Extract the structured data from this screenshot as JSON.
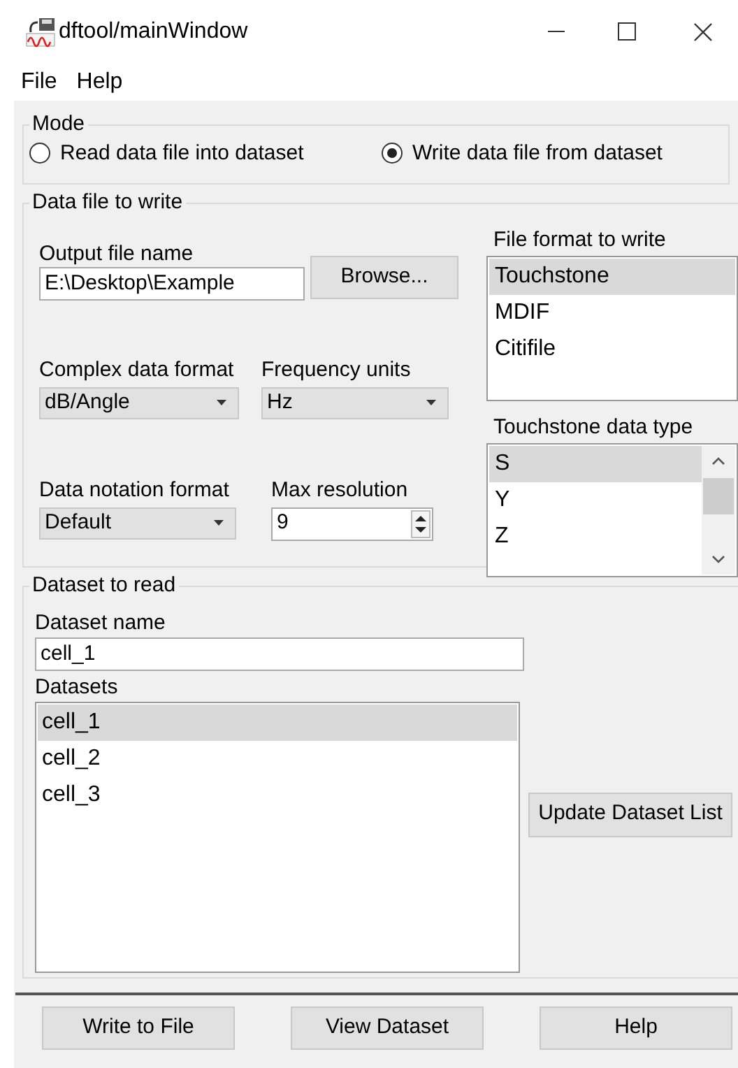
{
  "window": {
    "title": "dftool/mainWindow"
  },
  "menu": [
    "File",
    "Help"
  ],
  "mode": {
    "title": "Mode",
    "options": [
      {
        "label": "Read data file into dataset",
        "selected": false
      },
      {
        "label": "Write data file from dataset",
        "selected": true
      }
    ]
  },
  "write_group": {
    "title": "Data file to write",
    "output_file": {
      "label": "Output file name",
      "value": "E:\\Desktop\\Example",
      "browse": "Browse..."
    },
    "complex_format": {
      "label": "Complex data format",
      "value": "dB/Angle"
    },
    "frequency_units": {
      "label": "Frequency units",
      "value": "Hz"
    },
    "notation_format": {
      "label": "Data notation format",
      "value": "Default"
    },
    "max_resolution": {
      "label": "Max resolution",
      "value": "9"
    },
    "file_format": {
      "label": "File format to write",
      "items": [
        {
          "label": "Touchstone",
          "selected": true
        },
        {
          "label": "MDIF",
          "selected": false
        },
        {
          "label": "Citifile",
          "selected": false
        }
      ]
    },
    "data_type": {
      "label": "Touchstone data type",
      "items": [
        {
          "label": "S",
          "selected": true
        },
        {
          "label": "Y",
          "selected": false
        },
        {
          "label": "Z",
          "selected": false
        }
      ]
    }
  },
  "read_group": {
    "title": "Dataset to read",
    "name_label": "Dataset name",
    "name_value": "cell_1",
    "list_label": "Datasets",
    "datasets": [
      {
        "label": "cell_1",
        "selected": true
      },
      {
        "label": "cell_2",
        "selected": false
      },
      {
        "label": "cell_3",
        "selected": false
      }
    ],
    "update_button": "Update Dataset List"
  },
  "buttons": [
    "Write to File",
    "View Dataset",
    "Help"
  ]
}
